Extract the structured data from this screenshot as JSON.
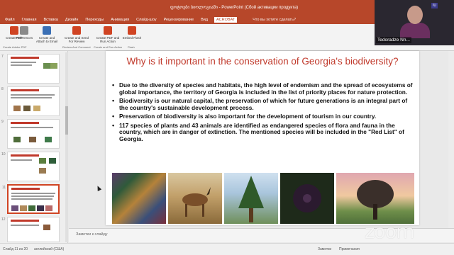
{
  "window": {
    "title": "ფოტოები ბიოლოგიაში - PowerPoint (Сбой активации продукта)"
  },
  "ribbon_tabs": [
    {
      "label": "Файл",
      "active": false
    },
    {
      "label": "Главная",
      "active": false
    },
    {
      "label": "Вставка",
      "active": false
    },
    {
      "label": "Дизайн",
      "active": false
    },
    {
      "label": "Переходы",
      "active": false
    },
    {
      "label": "Анимация",
      "active": false
    },
    {
      "label": "Слайд-шоу",
      "active": false
    },
    {
      "label": "Рецензирование",
      "active": false
    },
    {
      "label": "Вид",
      "active": false
    },
    {
      "label": "ACROBAT",
      "active": true
    }
  ],
  "tell_me": "Что вы хотите сделать?",
  "ribbon_buttons": [
    {
      "label": "Create PDF",
      "icon": "pdf-icon"
    },
    {
      "label": "Preferences",
      "icon": "gear-icon"
    },
    {
      "label": "Create and Attach to Email",
      "icon": "mail-icon"
    },
    {
      "label": "Create and Send For Review",
      "icon": "review-icon"
    },
    {
      "label": "Create PDF and Run Action",
      "icon": "action-icon"
    },
    {
      "label": "Embed Flash",
      "icon": "flash-icon"
    }
  ],
  "ribbon_groups": [
    "Create Adobe PDF",
    "Review And Comment",
    "Create and Run Action",
    "Flash"
  ],
  "participant": {
    "name": "Tedoradze Nn..."
  },
  "thumbnails": [
    {
      "number": "7",
      "selected": false
    },
    {
      "number": "8",
      "selected": false
    },
    {
      "number": "9",
      "selected": false
    },
    {
      "number": "10",
      "selected": false
    },
    {
      "number": "11",
      "selected": true
    },
    {
      "number": "12",
      "selected": false
    }
  ],
  "slide": {
    "title": "Why is it important in the conservation of Georgia's biodiversity?",
    "bullets": [
      "Due to the diversity of species and habitats, the high level of endemism and the spread of ecosystems of global importance, the territory of Georgia is included in the list of priority places for nature protection.",
      "Biodiversity is our natural capital, the preservation of which for future generations is an integral part of the country's sustainable development process.",
      " Preservation of biodiversity is also important for the development of tourism in our country.",
      "117 species of plants and 43 animals are identified as endangered species of flora and fauna in the country, which are in danger of extinction. The mentioned species will be included in the \"Red List\" of Georgia."
    ]
  },
  "notes_placeholder": "Заметки к слайду",
  "status": {
    "slide_position": "Слайд 11 из 20",
    "language": "английский (США)",
    "notes": "Заметки",
    "comments": "Примечания"
  },
  "watermark": "zoom",
  "colors": {
    "accent": "#b7472a",
    "title_red": "#c0392b"
  }
}
